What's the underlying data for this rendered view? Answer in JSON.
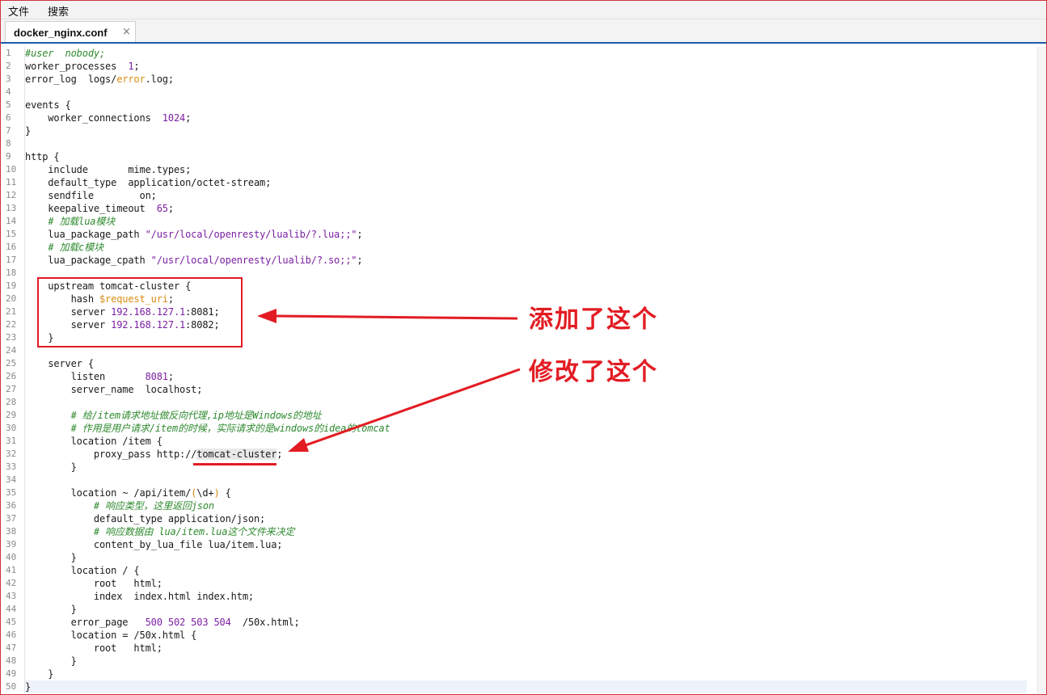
{
  "menu": {
    "items": [
      "文件",
      "搜索"
    ]
  },
  "tabs": [
    {
      "label": "docker_nginx.conf",
      "close": "×"
    }
  ],
  "editor": {
    "lines": [
      [
        {
          "t": "#user  nobody;",
          "c": "com"
        }
      ],
      [
        {
          "t": "worker_processes  "
        },
        {
          "t": "1",
          "c": "num"
        },
        {
          "t": ";"
        }
      ],
      [
        {
          "t": "error_log  logs/"
        },
        {
          "t": "error",
          "c": "kw"
        },
        {
          "t": ".log;"
        }
      ],
      [],
      [
        {
          "t": "events {"
        }
      ],
      [
        {
          "t": "    worker_connections  "
        },
        {
          "t": "1024",
          "c": "num"
        },
        {
          "t": ";"
        }
      ],
      [
        {
          "t": "}"
        }
      ],
      [],
      [
        {
          "t": "http {"
        }
      ],
      [
        {
          "t": "    include       mime.types;"
        }
      ],
      [
        {
          "t": "    default_type  application/octet-stream;"
        }
      ],
      [
        {
          "t": "    sendfile        on;"
        }
      ],
      [
        {
          "t": "    keepalive_timeout  "
        },
        {
          "t": "65",
          "c": "num"
        },
        {
          "t": ";"
        }
      ],
      [
        {
          "t": "    "
        },
        {
          "t": "# 加载lua模块",
          "c": "com"
        }
      ],
      [
        {
          "t": "    lua_package_path "
        },
        {
          "t": "\"/usr/local/openresty/lualib/?.lua;;\"",
          "c": "str"
        },
        {
          "t": ";"
        }
      ],
      [
        {
          "t": "    "
        },
        {
          "t": "# 加载c模块",
          "c": "com"
        }
      ],
      [
        {
          "t": "    lua_package_cpath "
        },
        {
          "t": "\"/usr/local/openresty/lualib/?.so;;\"",
          "c": "str"
        },
        {
          "t": ";"
        }
      ],
      [],
      [
        {
          "t": "    upstream tomcat-cluster {"
        }
      ],
      [
        {
          "t": "        hash "
        },
        {
          "t": "$request_uri",
          "c": "var"
        },
        {
          "t": ";"
        }
      ],
      [
        {
          "t": "        server "
        },
        {
          "t": "192.168.127.1",
          "c": "num"
        },
        {
          "t": ":8081;"
        }
      ],
      [
        {
          "t": "        server "
        },
        {
          "t": "192.168.127.1",
          "c": "num"
        },
        {
          "t": ":8082;"
        }
      ],
      [
        {
          "t": "    }"
        }
      ],
      [],
      [
        {
          "t": "    server {"
        }
      ],
      [
        {
          "t": "        listen       "
        },
        {
          "t": "8081",
          "c": "num"
        },
        {
          "t": ";"
        }
      ],
      [
        {
          "t": "        server_name  localhost;"
        }
      ],
      [],
      [
        {
          "t": "        "
        },
        {
          "t": "# 给/item请求地址做反向代理,ip地址是Windows的地址",
          "c": "com"
        }
      ],
      [
        {
          "t": "        "
        },
        {
          "t": "# 作用是用户请求/item的时候，实际请求的是windows的idea的tomcat",
          "c": "com"
        }
      ],
      [
        {
          "t": "        location /item {"
        }
      ],
      [
        {
          "t": "            proxy_pass http://"
        },
        {
          "t": "tomcat-cluster",
          "c": "hl"
        },
        {
          "t": ";"
        }
      ],
      [
        {
          "t": "        }"
        }
      ],
      [],
      [
        {
          "t": "        location ~ /api/item/"
        },
        {
          "t": "(",
          "c": "kw"
        },
        {
          "t": "\\d+"
        },
        {
          "t": ")",
          "c": "kw"
        },
        {
          "t": " {"
        }
      ],
      [
        {
          "t": "            "
        },
        {
          "t": "# 响应类型，这里返回json",
          "c": "com"
        }
      ],
      [
        {
          "t": "            default_type application/json;"
        }
      ],
      [
        {
          "t": "            "
        },
        {
          "t": "# 响应数据由 lua/item.lua这个文件来决定",
          "c": "com"
        }
      ],
      [
        {
          "t": "            content_by_lua_file lua/item.lua;"
        }
      ],
      [
        {
          "t": "        }"
        }
      ],
      [
        {
          "t": "        location / {"
        }
      ],
      [
        {
          "t": "            root   html;"
        }
      ],
      [
        {
          "t": "            index  index.html index.htm;"
        }
      ],
      [
        {
          "t": "        }"
        }
      ],
      [
        {
          "t": "        error_page   "
        },
        {
          "t": "500 502 503 504",
          "c": "num"
        },
        {
          "t": "  /50x.html;"
        }
      ],
      [
        {
          "t": "        location = /50x.html {"
        }
      ],
      [
        {
          "t": "            root   html;"
        }
      ],
      [
        {
          "t": "        }"
        }
      ],
      [
        {
          "t": "    }"
        }
      ],
      [
        {
          "t": "}"
        }
      ]
    ]
  },
  "annotations": {
    "added": "添加了这个",
    "modified": "修改了这个"
  },
  "colors": {
    "annotation": "#e31c23",
    "comment": "#2f8a2f",
    "number": "#7b1fa2",
    "variable": "#d88b10",
    "tab_underline": "#1e5ea8"
  }
}
